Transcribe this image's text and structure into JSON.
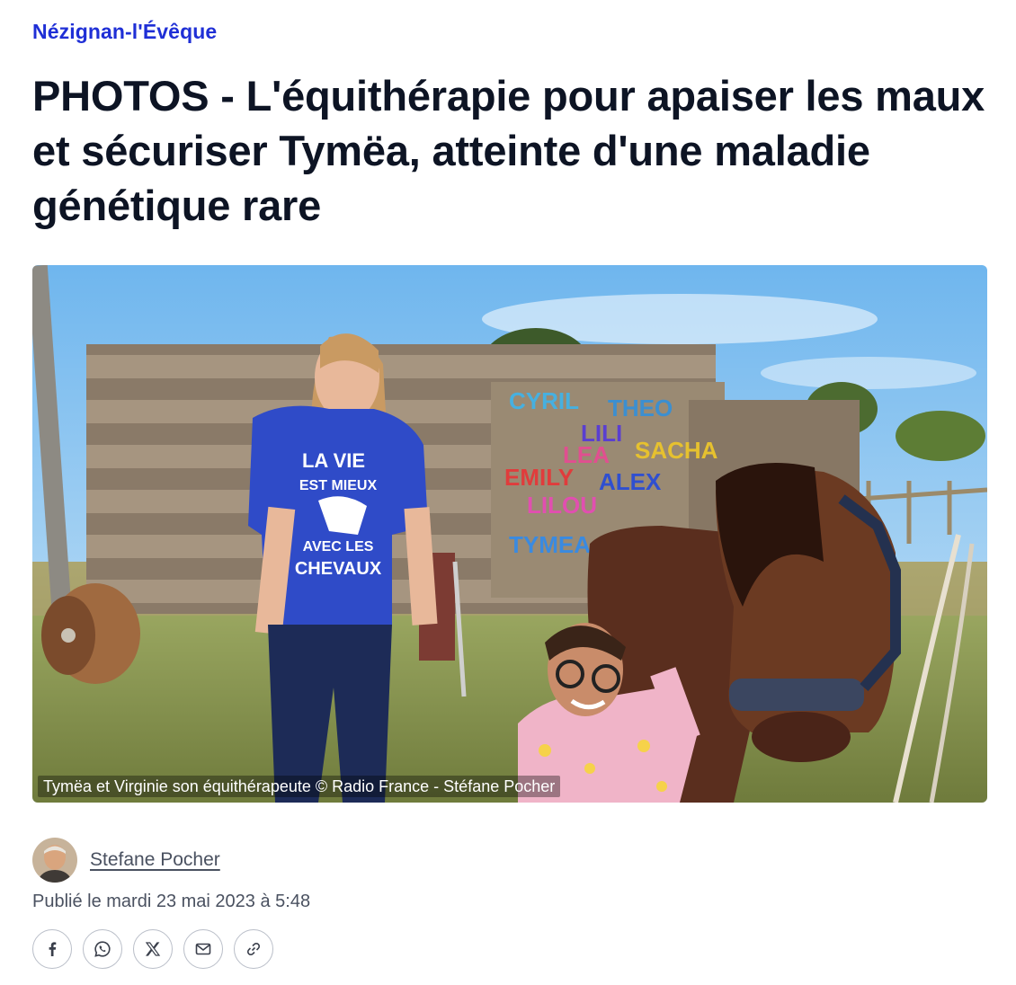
{
  "article": {
    "kicker": "Nézignan-l'Évêque",
    "headline": "PHOTOS - L'équithérapie pour apaiser les maux et sécuriser Tymëa, atteinte d'une maladie génétique rare",
    "image": {
      "caption": "Tymëa et Virginie son équithérapeute © Radio France - Stéfane Pocher",
      "shirt_text": [
        "LA VIE",
        "EST MIEUX",
        "AVEC LES",
        "CHEVAUX"
      ],
      "fence_names": [
        "CYRIL",
        "THEO",
        "LILI",
        "LEA",
        "SACHA",
        "EMILY",
        "ALEX",
        "LILOU",
        "TYMEA"
      ]
    },
    "author": {
      "name": "Stefane Pocher"
    },
    "published": "Publié le mardi 23 mai 2023 à 5:48"
  },
  "share": [
    {
      "id": "facebook",
      "icon": "facebook-icon"
    },
    {
      "id": "whatsapp",
      "icon": "whatsapp-icon"
    },
    {
      "id": "x",
      "icon": "x-icon"
    },
    {
      "id": "email",
      "icon": "mail-icon"
    },
    {
      "id": "link",
      "icon": "link-icon"
    }
  ],
  "colors": {
    "kicker": "#1f2fd6",
    "headline": "#0d1424",
    "meta": "#4a5160"
  }
}
